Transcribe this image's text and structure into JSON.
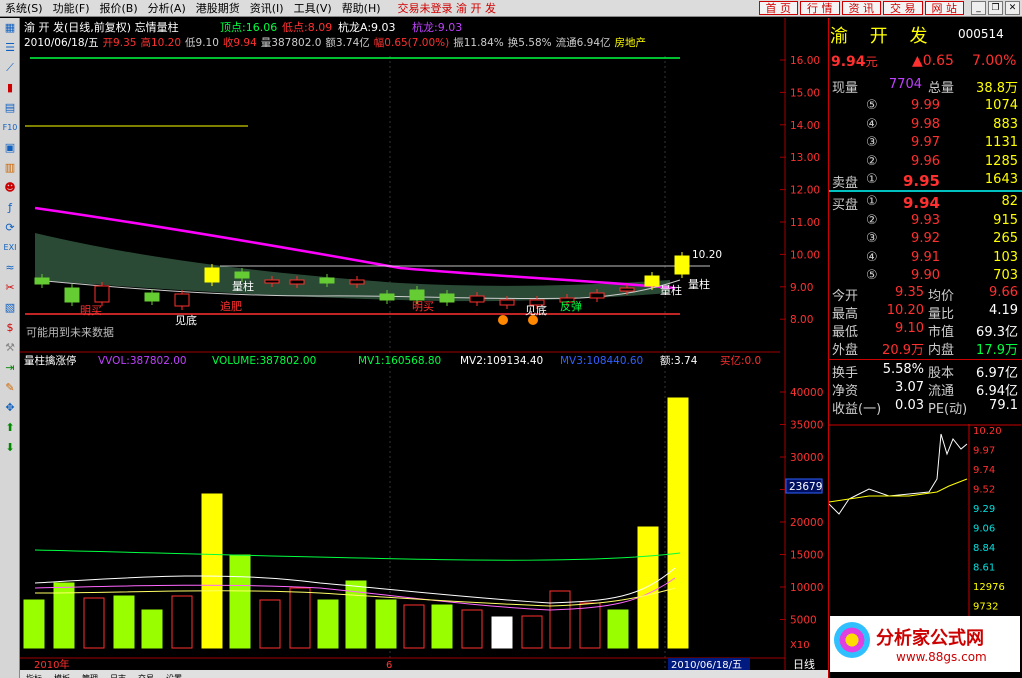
{
  "menu": {
    "items": [
      "系统(S)",
      "功能(F)",
      "报价(B)",
      "分析(A)",
      "港股期货",
      "资讯(I)",
      "工具(V)",
      "帮助(H)"
    ],
    "warning": "交易未登录 渝 开 发"
  },
  "nav": {
    "buttons": [
      "首 页",
      "行 情",
      "资 讯",
      "交 易",
      "网 站"
    ]
  },
  "header": {
    "title": "渝 开 发(日线,前复权) 忘情量柱",
    "items": [
      {
        "label": "顶点:16.06",
        "color": "#00ff40"
      },
      {
        "label": "低点:8.09",
        "color": "#ff3030"
      },
      {
        "label": "杭龙A:9.03",
        "color": "#ffffff"
      },
      {
        "label": "杭龙:9.03",
        "color": "#c040ff"
      }
    ],
    "line2": [
      "2010/06/18/五",
      "开9.35",
      "高10.20",
      "低9.10",
      "收9.94",
      "量387802.0",
      "额3.74亿",
      "幅0.65(7.00%)",
      "振11.84%",
      "换5.58%",
      "流通6.94亿",
      "房地产"
    ]
  },
  "price_axis": {
    "ticks": [
      "16.00",
      "15.00",
      "14.00",
      "13.00",
      "12.00",
      "11.00",
      "10.00",
      "9.00",
      "8.00"
    ]
  },
  "volume_axis": {
    "ticks": [
      "40000",
      "35000",
      "30000",
      "25000",
      "20000",
      "15000",
      "10000",
      "5000"
    ],
    "unit": "X10",
    "cursor": "23679"
  },
  "annotations": {
    "price_high": "10.20",
    "signal_labels": [
      "明买",
      "见底",
      "追肥",
      "量柱",
      "明买",
      "见底",
      "反弹",
      "量柱",
      "量柱"
    ],
    "note": "可能用到未来数据"
  },
  "vol_legend": {
    "items": [
      "量柱擒涨停",
      "VVOL:387802.00",
      "VOLUME:387802.00",
      "MV1:160568.80",
      "MV2:109134.40",
      "MV3:108440.60",
      "额:3.74",
      "买亿:0.0"
    ]
  },
  "date_axis": {
    "start": "2010年",
    "mid": "6",
    "end": "2010/06/18/五",
    "period": "日线"
  },
  "quote": {
    "name": "渝 开 发",
    "code": "000514",
    "price": "9.94",
    "unit": "元",
    "change": "▲0.65",
    "change_pct": "7.00%",
    "now_vol_label": "现量",
    "now_vol": "7704",
    "total_vol_label": "总量",
    "total_vol": "38.8万",
    "asks": [
      {
        "lvl": "⑤",
        "price": "9.99",
        "vol": "1074"
      },
      {
        "lvl": "④",
        "price": "9.98",
        "vol": "883"
      },
      {
        "lvl": "③",
        "price": "9.97",
        "vol": "1131"
      },
      {
        "lvl": "②",
        "price": "9.96",
        "vol": "1285"
      },
      {
        "lvl": "①",
        "price": "9.95",
        "vol": "1643"
      }
    ],
    "ask_label": "卖盘",
    "bids": [
      {
        "lvl": "①",
        "price": "9.94",
        "vol": "82"
      },
      {
        "lvl": "②",
        "price": "9.93",
        "vol": "915"
      },
      {
        "lvl": "③",
        "price": "9.92",
        "vol": "265"
      },
      {
        "lvl": "④",
        "price": "9.91",
        "vol": "103"
      },
      {
        "lvl": "⑤",
        "price": "9.90",
        "vol": "703"
      }
    ],
    "bid_label": "买盘",
    "stats": [
      {
        "k1": "今开",
        "v1": "9.35",
        "k2": "均价",
        "v2": "9.66"
      },
      {
        "k1": "最高",
        "v1": "10.20",
        "k2": "量比",
        "v2": "4.19"
      },
      {
        "k1": "最低",
        "v1": "9.10",
        "k2": "市值",
        "v2": "69.3亿"
      },
      {
        "k1": "外盘",
        "v1": "20.9万",
        "k2": "内盘",
        "v2": "17.9万"
      }
    ],
    "stats2": [
      {
        "k1": "换手",
        "v1": "5.58%",
        "k2": "股本",
        "v2": "6.97亿"
      },
      {
        "k1": "净资",
        "v1": "3.07",
        "k2": "流通",
        "v2": "6.94亿"
      },
      {
        "k1": "收益(一)",
        "v1": "0.03",
        "k2": "PE(动)",
        "v2": "79.1"
      }
    ],
    "mini_axis": [
      "10.20",
      "9.97",
      "9.74",
      "9.52",
      "9.29",
      "9.06",
      "8.84",
      "8.61",
      "12976",
      "9732"
    ]
  },
  "logo": {
    "text": "分析家公式网",
    "url": "www.88gs.com"
  },
  "bottom_tabs": [
    "指标",
    "模板",
    "管理",
    "日志",
    "交易",
    "设置"
  ],
  "colors": {
    "up": "#ff3030",
    "down": "#00ff40",
    "ma_magenta": "#ff00ff",
    "cloud": "#1f3d2a",
    "yellow": "#ffff00",
    "lime": "#99ff00"
  }
}
